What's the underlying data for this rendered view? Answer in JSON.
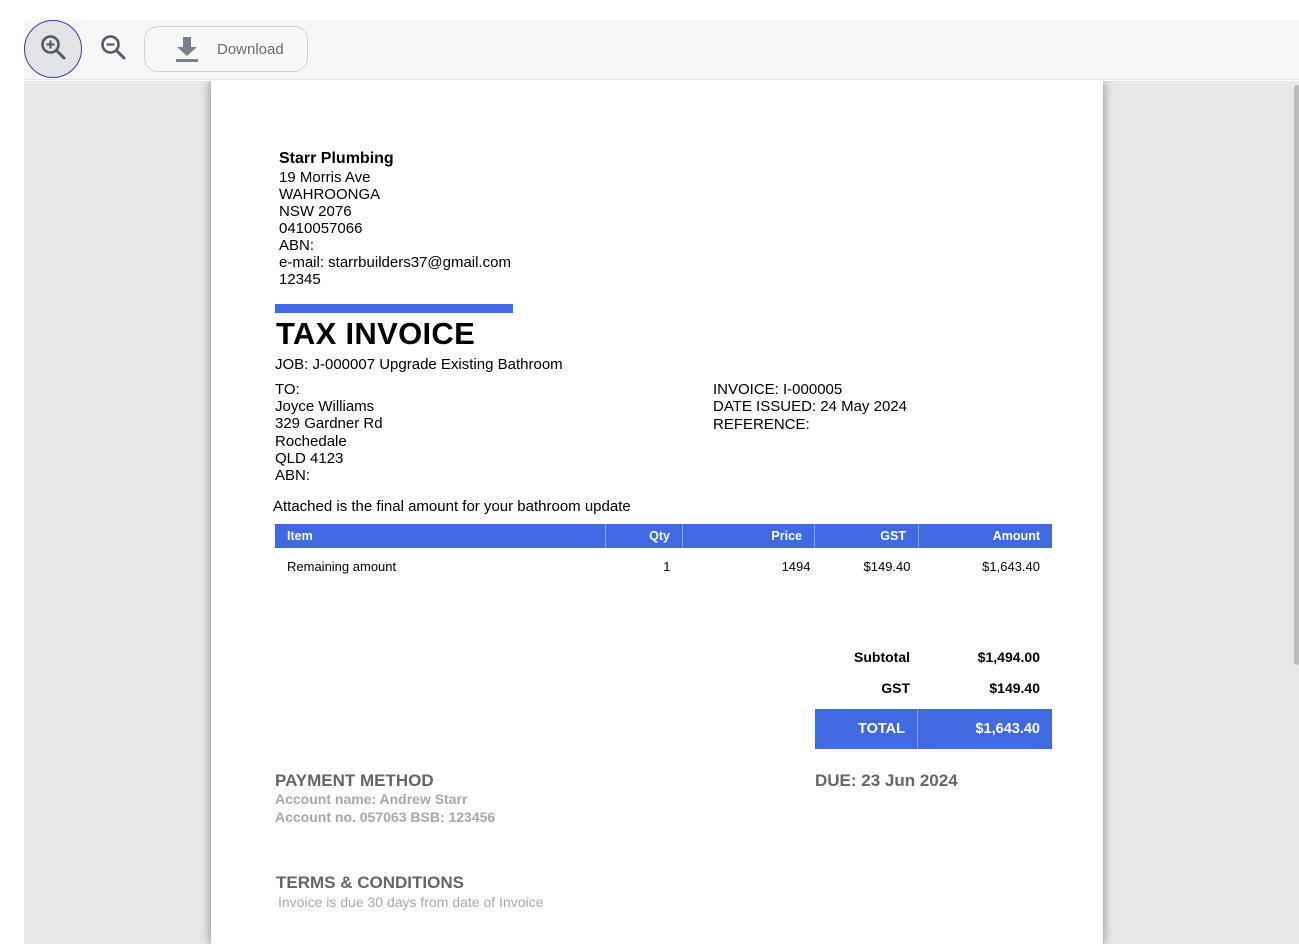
{
  "toolbar": {
    "download_label": "Download"
  },
  "company": {
    "name": "Starr Plumbing",
    "address1": "19 Morris Ave",
    "suburb": "WAHROONGA",
    "state_postcode": "NSW 2076",
    "phone": "0410057066",
    "abn": "ABN:",
    "email": "e-mail: starrbuilders37@gmail.com",
    "extra": "12345"
  },
  "invoice": {
    "title": "TAX INVOICE",
    "job": "JOB: J-000007  Upgrade Existing Bathroom",
    "to": {
      "label": "TO:",
      "name": "Joyce Williams",
      "street": "329 Gardner Rd",
      "suburb": "Rochedale",
      "state_postcode": "QLD 4123",
      "abn": "ABN:"
    },
    "number": "INVOICE: I-000005",
    "date_issued": "DATE ISSUED: 24 May 2024",
    "reference": "REFERENCE:",
    "intro": "Attached is the final amount for your bathroom update"
  },
  "table": {
    "headers": {
      "item": "Item",
      "qty": "Qty",
      "price": "Price",
      "gst": "GST",
      "amount": "Amount"
    },
    "rows": [
      {
        "item": "Remaining amount",
        "qty": "1",
        "price": "1494",
        "gst": "$149.40",
        "amount": "$1,643.40"
      }
    ]
  },
  "totals": {
    "subtotal_label": "Subtotal",
    "subtotal": "$1,494.00",
    "gst_label": "GST",
    "gst": "$149.40",
    "total_label": "TOTAL",
    "total": "$1,643.40"
  },
  "payment": {
    "heading": "PAYMENT METHOD",
    "account_name": "Account name: Andrew Starr",
    "account_no": "Account no. 057063 BSB: 123456",
    "due": "DUE: 23 Jun 2024"
  },
  "terms": {
    "heading": "TERMS & CONDITIONS",
    "text": "Invoice is due 30 days from date of Invoice"
  },
  "colors": {
    "accent": "#4169e1",
    "viewer_background": "#e8e8ea",
    "muted_text": "#a8a8a8"
  },
  "icons": [
    "zoom-in-icon",
    "zoom-out-icon",
    "download-icon"
  ]
}
